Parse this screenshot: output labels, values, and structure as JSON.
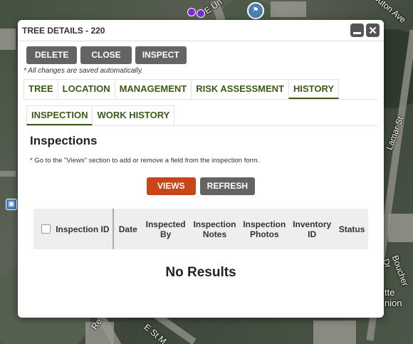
{
  "map": {
    "street_labels": [
      "E Un",
      "Suton Ave",
      "Lamar St",
      "Boucher Dr",
      "E St M",
      "Re"
    ],
    "place_label_lines": [
      "tte",
      "nion"
    ]
  },
  "dialog": {
    "title": "TREE DETAILS - 220",
    "buttons": {
      "delete": "DELETE",
      "close": "CLOSE",
      "inspect": "INSPECT"
    },
    "autosave_note": "* All changes are saved automatically.",
    "main_tabs": [
      "TREE",
      "LOCATION",
      "MANAGEMENT",
      "RISK ASSESSMENT",
      "HISTORY"
    ],
    "active_main_tab": "HISTORY",
    "sub_tabs": [
      "INSPECTION",
      "WORK HISTORY"
    ],
    "active_sub_tab": "INSPECTION",
    "section_title": "Inspections",
    "hint": "* Go to the \"Views\" section to add or remove a field from the inspection form.",
    "action_buttons": {
      "views": "VIEWS",
      "refresh": "REFRESH"
    },
    "columns": [
      "Inspection ID",
      "Date",
      "Inspected By",
      "Inspection Notes",
      "Inspection Photos",
      "Inventory ID",
      "Status"
    ],
    "empty_message": "No Results"
  },
  "colors": {
    "accent_green": "#3d5a17",
    "views_orange": "#c9461b",
    "button_gray": "#646464"
  }
}
